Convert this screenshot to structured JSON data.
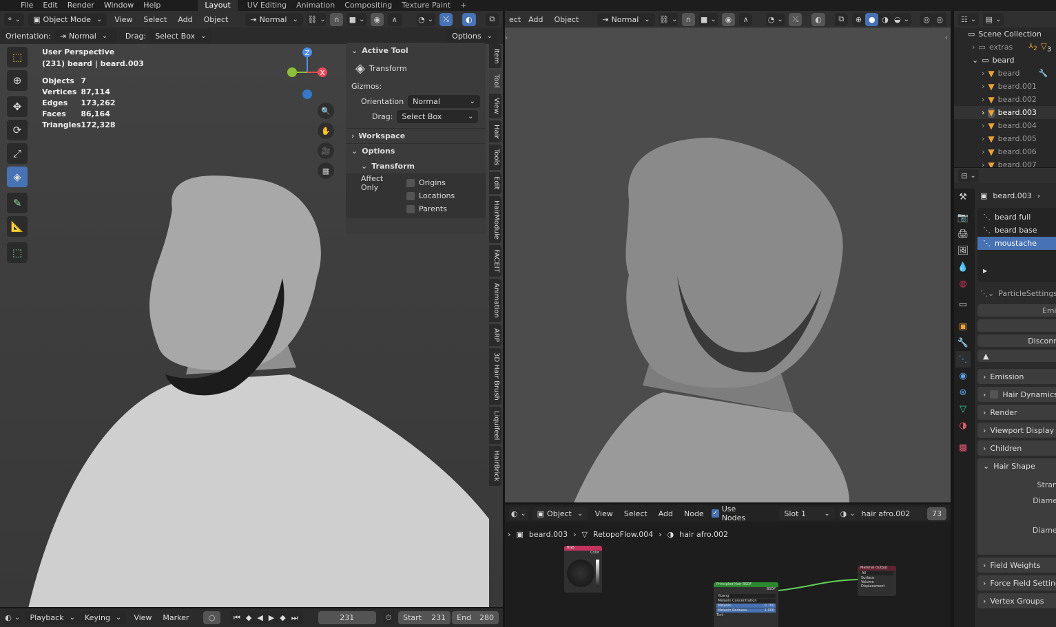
{
  "topbar": {
    "menus": [
      "File",
      "Edit",
      "Render",
      "Window",
      "Help"
    ],
    "workspaces": [
      "Layout",
      "UV Editing",
      "Animation",
      "Compositing",
      "Texture Paint",
      "+"
    ],
    "active_workspace": "Layout"
  },
  "viewport_left": {
    "header": {
      "mode": "Object Mode",
      "menus": [
        "View",
        "Select",
        "Add",
        "Object"
      ],
      "orientation": "Normal"
    },
    "tool_settings": {
      "orientation_label": "Orientation:",
      "orientation": "Normal",
      "drag_label": "Drag:",
      "drag": "Select Box",
      "options": "Options"
    },
    "overlay": {
      "title": "User Perspective",
      "subtitle": "(231) beard | beard.003",
      "stats": [
        {
          "label": "Objects",
          "value": "7"
        },
        {
          "label": "Vertices",
          "value": "87,114"
        },
        {
          "label": "Edges",
          "value": "173,262"
        },
        {
          "label": "Faces",
          "value": "86,164"
        },
        {
          "label": "Triangles",
          "value": "172,328"
        }
      ]
    },
    "gizmo": {
      "x": "X",
      "z": "Z"
    },
    "npanel": {
      "active_tool": "Active Tool",
      "tool_name": "Transform",
      "gizmos": "Gizmos:",
      "orientation_label": "Orientation",
      "orientation": "Normal",
      "drag_label": "Drag:",
      "drag": "Select Box",
      "workspace": "Workspace",
      "options": "Options",
      "transform": "Transform",
      "affect_only": "Affect Only",
      "checks": [
        "Origins",
        "Locations",
        "Parents"
      ]
    },
    "tabs": [
      "Item",
      "Tool",
      "View",
      "Hair",
      "Tools",
      "Edit",
      "HairModule",
      "FACEIT",
      "Animation",
      "ARP",
      "3D Hair Brush",
      "Liquifeel",
      "HairBrick"
    ],
    "active_tab": "Tool"
  },
  "viewport_right": {
    "header": {
      "menus": [
        "ect",
        "Add",
        "Object"
      ],
      "orientation": "Normal"
    }
  },
  "timeline": {
    "menus": [
      "Playback",
      "Keying",
      "View",
      "Marker"
    ],
    "frame": "231",
    "start_label": "Start",
    "start": "231",
    "end_label": "End",
    "end": "280"
  },
  "node_editor": {
    "header": {
      "type": "Object",
      "menus": [
        "View",
        "Select",
        "Add",
        "Node"
      ],
      "use_nodes": "Use Nodes",
      "slot": "Slot 1",
      "material": "hair afro.002",
      "users": "73"
    },
    "breadcrumb": [
      "beard.003",
      "RetopoFlow.004",
      "hair afro.002"
    ],
    "nodes": {
      "rgb": {
        "title": "RGB",
        "out": "Color"
      },
      "hair": {
        "title": "Principled Hair BSDF",
        "out": "BSDF",
        "model": "Huang",
        "param": "Melanin Concentration",
        "melanin_label": "Melanin",
        "melanin": "0.700",
        "redness_label": "Melanin Redness",
        "redness": "1.000",
        "tint": "Tint"
      },
      "output": {
        "title": "Material Output",
        "target": "All",
        "inputs": [
          "Surface",
          "Volume",
          "Displacement"
        ]
      }
    }
  },
  "outliner": {
    "root": "Scene Collection",
    "items": [
      {
        "name": "extras",
        "level": 1
      },
      {
        "name": "beard",
        "level": 1
      },
      {
        "name": "beard",
        "level": 2
      },
      {
        "name": "beard.001",
        "level": 2
      },
      {
        "name": "beard.002",
        "level": 2
      },
      {
        "name": "beard.003",
        "level": 2,
        "active": true
      },
      {
        "name": "beard.004",
        "level": 2
      },
      {
        "name": "beard.005",
        "level": 2
      },
      {
        "name": "beard.006",
        "level": 2
      },
      {
        "name": "beard.007",
        "level": 2
      }
    ],
    "extras_badges": [
      "2",
      "3"
    ]
  },
  "properties": {
    "object": "beard.003",
    "particle_systems": [
      "beard full",
      "beard base",
      "moustache"
    ],
    "selected": "moustache",
    "settings": "ParticleSettings",
    "buttons": [
      "Emitte",
      "",
      "Disconnec",
      "UP"
    ],
    "sections": [
      "Emission",
      "Hair Dynamics",
      "Render",
      "Viewport Display",
      "Children",
      "Hair Shape",
      "Field Weights",
      "Force Field Settings",
      "Vertex Groups"
    ],
    "hair_shape_fields": [
      "Stran",
      "Diame",
      "Diamet"
    ]
  },
  "colors": {
    "accent": "#4772b3",
    "node_link": "#63d159",
    "hair_node": "#2b8a2e",
    "rgb_node": "#c2335e",
    "output_node": "#5e2231"
  }
}
